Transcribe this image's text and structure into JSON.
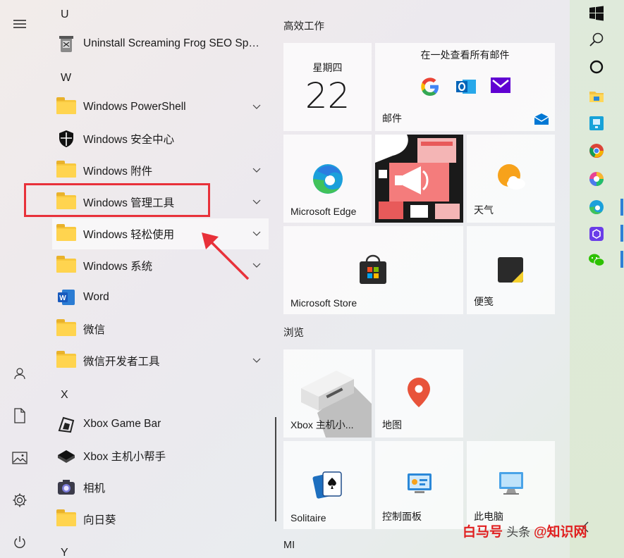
{
  "app_list": {
    "letters": {
      "u": "U",
      "w": "W",
      "x": "X",
      "y": "Y"
    },
    "items": {
      "uninstall": "Uninstall Screaming Frog SEO Spid...",
      "powershell": "Windows PowerShell",
      "security": "Windows 安全中心",
      "accessories": "Windows 附件",
      "admin_tools": "Windows 管理工具",
      "ease_of_access": "Windows 轻松使用",
      "system": "Windows 系统",
      "word": "Word",
      "wechat": "微信",
      "wechat_devtools": "微信开发者工具",
      "xbox_game_bar": "Xbox Game Bar",
      "xbox_companion": "Xbox 主机小帮手",
      "camera": "相机",
      "sunflower": "向日葵"
    }
  },
  "tiles": {
    "group_productivity": "高效工作",
    "group_browse": "浏览",
    "group_mi": "MI",
    "calendar": {
      "weekday": "星期四",
      "day": "22"
    },
    "mail": {
      "header": "在一处查看所有邮件",
      "label": "邮件"
    },
    "edge": "Microsoft Edge",
    "weather": "天气",
    "store": "Microsoft Store",
    "sticky": "便笺",
    "xbox": "Xbox 主机小...",
    "maps": "地图",
    "solitaire": "Solitaire",
    "control_panel": "控制面板",
    "this_pc": "此电脑"
  },
  "watermark": {
    "part1": "白马号",
    "part2": "头条 ",
    "part3": "@知识网"
  },
  "colors": {
    "highlight_box": "#e8313a",
    "folder": "#ffd44f",
    "taskbar": "#dfeadb"
  }
}
